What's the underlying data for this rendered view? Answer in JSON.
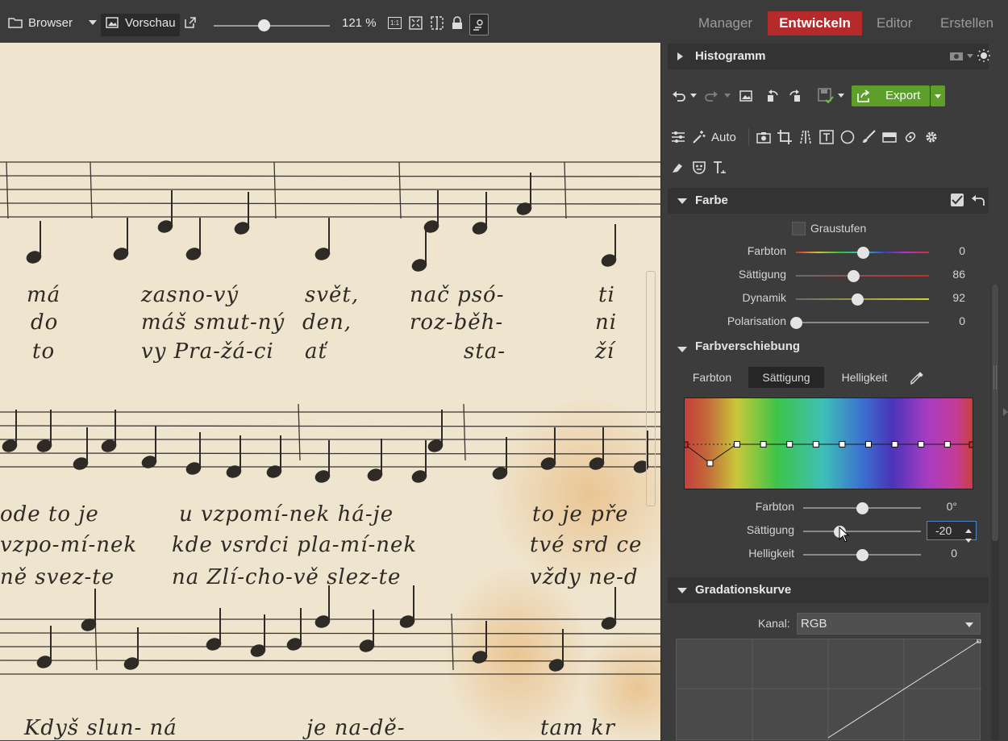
{
  "toolbar": {
    "browser_label": "Browser",
    "vorschau_label": "Vorschau",
    "zoom_value": "121 %",
    "zoom_fraction": 0.38,
    "one_to_one_label": "1:1",
    "modes": [
      {
        "label": "Manager",
        "active": false
      },
      {
        "label": "Entwickeln",
        "active": true
      },
      {
        "label": "Editor",
        "active": false
      },
      {
        "label": "Erstellen",
        "active": false
      }
    ],
    "accent_color": "#b52a2a"
  },
  "canvas": {
    "lyrics": [
      "má",
      "zasno-vý",
      "svět,",
      "nač psó-",
      "ti",
      "do",
      "máš smut-ný",
      "den,",
      "roz-běh-",
      "ni",
      "to",
      "vy Pra-žá-ci",
      "ať",
      "sta-",
      "ží",
      "ode to je",
      "u vzpomí-nek há-je",
      "to je pře",
      "vzpo-mí-nek",
      "kde vsrdci pla-mí-nek",
      "tvé srd ce",
      "ně svez-te",
      "na Zlí-cho-vě slez-te",
      "vždy ne-d",
      "Kdyš slun- ná",
      "je na-dě-",
      "tam kr"
    ]
  },
  "panel": {
    "histogram": {
      "title": "Histogramm"
    },
    "export_label": "Export",
    "tool_auto_label": "Auto",
    "farbe": {
      "title": "Farbe",
      "graustufen_label": "Graustufen",
      "graustufen_checked": false,
      "sliders": [
        {
          "label": "Farbton",
          "value": "0",
          "fraction": 0.5,
          "track": "hue"
        },
        {
          "label": "Sättigung",
          "value": "86",
          "fraction": 0.43,
          "track": "sat"
        },
        {
          "label": "Dynamik",
          "value": "92",
          "fraction": 0.46,
          "track": "dyn"
        },
        {
          "label": "Polarisation",
          "value": "0",
          "fraction": 0.0,
          "track": "plain"
        }
      ]
    },
    "farbverschiebung": {
      "title": "Farbverschiebung",
      "tabs": [
        "Farbton",
        "Sättigung",
        "Helligkeit"
      ],
      "active_tab": "Sättigung",
      "sliders": [
        {
          "label": "Farbton",
          "value": "0°",
          "fraction": 0.5
        },
        {
          "label": "Sättigung",
          "value": "-20",
          "fraction": 0.31
        },
        {
          "label": "Helligkeit",
          "value": "0",
          "fraction": 0.5
        }
      ]
    },
    "gradationskurve": {
      "title": "Gradationskurve",
      "kanal_label": "Kanal:",
      "kanal_value": "RGB"
    }
  }
}
